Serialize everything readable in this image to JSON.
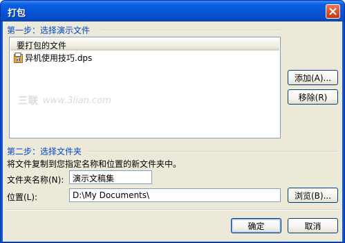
{
  "window": {
    "title": "打包"
  },
  "step1": {
    "label": "第一步：选择演示文件",
    "list_header": "要打包的文件",
    "files": [
      {
        "name": "异机使用技巧.dps"
      }
    ],
    "add_button": "添加(A)...",
    "remove_button": "移除(R)"
  },
  "watermark": {
    "logo_text": "三联",
    "site": "www.3lian.com"
  },
  "step2": {
    "label": "第二步：选择文件夹",
    "description": "将文件复制到您指定名称和位置的新文件夹中。",
    "folder_name_label": "文件夹名称(N):",
    "folder_name_value": "演示文稿集",
    "location_label": "位置(L):",
    "location_value": "D:\\My Documents\\",
    "browse_button": "浏览(B)..."
  },
  "footer": {
    "ok_button": "确定",
    "cancel_button": "取消"
  },
  "colors": {
    "titlebar": "#0a58d8",
    "dialog_bg": "#ece9d8",
    "section_label": "#0046d5"
  }
}
